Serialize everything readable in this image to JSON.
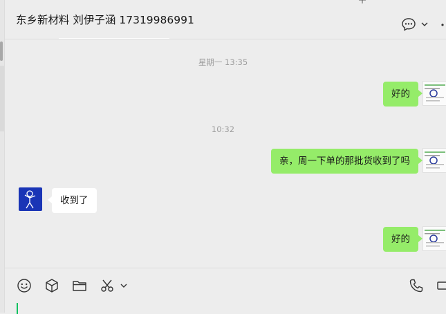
{
  "header": {
    "title": "东乡新材料 刘伊子涵 17319986991"
  },
  "messages": [
    {
      "type": "timestamp",
      "text": "星期一 13:35"
    },
    {
      "type": "outgoing",
      "text": "好的"
    },
    {
      "type": "timestamp",
      "text": "10:32"
    },
    {
      "type": "outgoing",
      "text": "亲，周一下单的那批货收到了吗"
    },
    {
      "type": "incoming",
      "text": "收到了"
    },
    {
      "type": "outgoing",
      "text": "好的"
    }
  ],
  "icons": {
    "emoji": "smiley-icon",
    "favorites": "cube-icon",
    "file": "folder-icon",
    "screenshot": "scissors-icon",
    "voice_call": "phone-icon",
    "video_call": "video-icon",
    "chat_info": "chat-bubble-icon",
    "more": "more-icon"
  },
  "colors": {
    "outgoing_bubble": "#95ec69",
    "incoming_bubble": "#ffffff",
    "background": "#ededed",
    "peer_avatar": "#1a35b6",
    "caret": "#07c160"
  }
}
